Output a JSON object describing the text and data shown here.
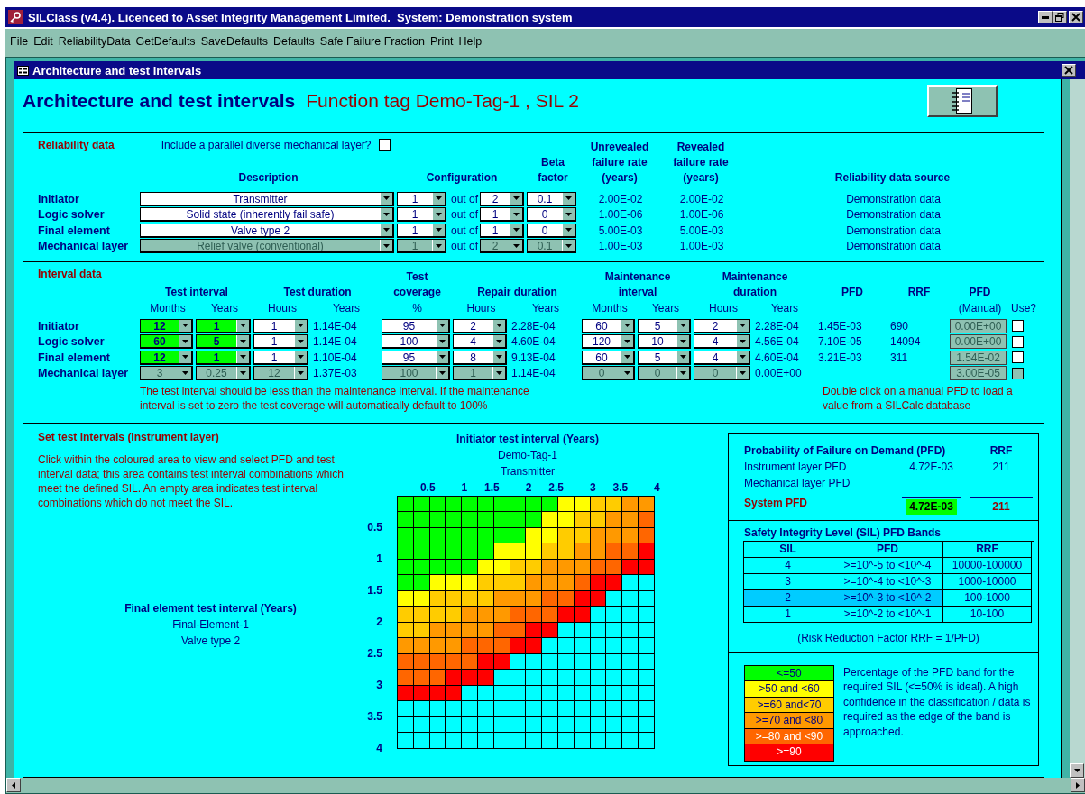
{
  "window": {
    "title": "SILClass (v4.4). Licenced to Asset Integrity Management Limited.  System: Demonstration system"
  },
  "menu": [
    "File",
    "Edit",
    "ReliabilityData",
    "GetDefaults",
    "SaveDefaults",
    "Defaults",
    "Safe Failure Fraction",
    "Print",
    "Help"
  ],
  "form": {
    "title": "Architecture and test intervals"
  },
  "heading": {
    "title": "Architecture and test intervals",
    "subtitle": "Function tag Demo-Tag-1 , SIL 2"
  },
  "reliability": {
    "label": "Reliability data",
    "parallel_label": "Include a parallel diverse mechanical layer?",
    "parallel_checked": false,
    "headers": {
      "description": "Description",
      "configuration": "Configuration",
      "beta": "Beta factor",
      "unrevealed": "Unrevealed failure rate (years)",
      "revealed": "Revealed failure rate (years)",
      "source": "Reliability data source"
    },
    "rows": [
      {
        "name": "Initiator",
        "description": "Transmitter",
        "m": "1",
        "out_of": "out of",
        "n": "2",
        "beta": "0.1",
        "unrevealed": "2.00E-02",
        "revealed": "2.00E-02",
        "source": "Demonstration data",
        "disabled": false
      },
      {
        "name": "Logic solver",
        "description": "Solid state (inherently fail safe)",
        "m": "1",
        "out_of": "out of",
        "n": "1",
        "beta": "0",
        "unrevealed": "1.00E-06",
        "revealed": "1.00E-06",
        "source": "Demonstration data",
        "disabled": false
      },
      {
        "name": "Final element",
        "description": "Valve type 2",
        "m": "1",
        "out_of": "out of",
        "n": "1",
        "beta": "0",
        "unrevealed": "5.00E-03",
        "revealed": "5.00E-03",
        "source": "Demonstration data",
        "disabled": false
      },
      {
        "name": "Mechanical layer",
        "description": "Relief valve (conventional)",
        "m": "1",
        "out_of": "out of",
        "n": "2",
        "beta": "0.1",
        "unrevealed": "1.00E-03",
        "revealed": "1.00E-03",
        "source": "Demonstration data",
        "disabled": true
      }
    ]
  },
  "interval": {
    "label": "Interval data",
    "columns": [
      {
        "group": "Test interval",
        "sub": "Months"
      },
      {
        "sub": "Years"
      },
      {
        "group": "Test duration",
        "sub": "Hours"
      },
      {
        "sub": "Years"
      },
      {
        "group": "Test coverage",
        "sub": "%"
      },
      {
        "group": "Repair duration",
        "sub": "Hours"
      },
      {
        "sub": "Years"
      },
      {
        "group": "Maintenance interval",
        "sub": "Months"
      },
      {
        "sub": "Years"
      },
      {
        "group": "Maintenance duration",
        "sub": "Hours"
      },
      {
        "sub": "Years"
      },
      {
        "group": "PFD"
      },
      {
        "group": "RRF"
      },
      {
        "group": "PFD",
        "sub": "(Manual)"
      },
      {
        "sub": "Use?"
      }
    ],
    "rows": [
      {
        "name": "Initiator",
        "highlight": true,
        "disabled": false,
        "ti_months": "12",
        "ti_years": "1",
        "td_hours": "1",
        "td_years": "1.14E-04",
        "coverage": "95",
        "rd_hours": "2",
        "rd_years": "2.28E-04",
        "mi_months": "60",
        "mi_years": "5",
        "md_hours": "2",
        "md_years": "2.28E-04",
        "pfd": "1.45E-03",
        "rrf": "690",
        "manual_pfd": "0.00E+00",
        "use": false
      },
      {
        "name": "Logic solver",
        "highlight": true,
        "disabled": false,
        "ti_months": "60",
        "ti_years": "5",
        "td_hours": "1",
        "td_years": "1.14E-04",
        "coverage": "100",
        "rd_hours": "4",
        "rd_years": "4.60E-04",
        "mi_months": "120",
        "mi_years": "10",
        "md_hours": "4",
        "md_years": "4.56E-04",
        "pfd": "7.10E-05",
        "rrf": "14094",
        "manual_pfd": "0.00E+00",
        "use": false
      },
      {
        "name": "Final element",
        "highlight": true,
        "disabled": false,
        "ti_months": "12",
        "ti_years": "1",
        "td_hours": "1",
        "td_years": "1.10E-04",
        "coverage": "95",
        "rd_hours": "8",
        "rd_years": "9.13E-04",
        "mi_months": "60",
        "mi_years": "5",
        "md_hours": "4",
        "md_years": "4.60E-04",
        "pfd": "3.21E-03",
        "rrf": "311",
        "manual_pfd": "1.54E-02",
        "use": false
      },
      {
        "name": "Mechanical layer",
        "highlight": false,
        "disabled": true,
        "ti_months": "3",
        "ti_years": "0.25",
        "td_hours": "12",
        "td_years": "1.37E-03",
        "coverage": "100",
        "rd_hours": "1",
        "rd_years": "1.14E-04",
        "mi_months": "0",
        "mi_years": "0",
        "md_hours": "0",
        "md_years": "0.00E+00",
        "manual_pfd": "3.00E-05",
        "use": false
      }
    ],
    "note": "The test interval should be less than the maintenance interval. If the maintenance interval is set to zero the  test coverage will automatically default to 100%",
    "manual_note": "Double click on a manual PFD to load a value from a SILCalc database"
  },
  "set_intervals": {
    "title": "Set test intervals (Instrument layer)",
    "text": "Click within the coloured area to view and select PFD and test interval data; this area contains test interval combinations which meet the defined SIL. An empty area indicates test interval combinations which do not meet the SIL.",
    "y_title": "Final element test interval (Years)",
    "y_tag": "Final-Element-1",
    "y_desc": "Valve type 2",
    "x_title": "Initiator test interval (Years)",
    "x_tag": "Demo-Tag-1",
    "x_desc": "Transmitter",
    "x_ticks": [
      "0.5",
      "1",
      "1.5",
      "2",
      "2.5",
      "3",
      "3.5",
      "4"
    ],
    "y_ticks": [
      "0.5",
      "1",
      "1.5",
      "2",
      "2.5",
      "3",
      "3.5",
      "4"
    ],
    "grid": [
      [
        {
          "color": "#00ff00"
        },
        {
          "color": "#00ff00"
        },
        {
          "color": "#00ff00"
        },
        {
          "color": "#00ff00"
        },
        {
          "color": "#00ff00"
        },
        {
          "color": "#00ff00"
        },
        {
          "color": "#00ff00"
        },
        {
          "color": "#00ff00"
        },
        {
          "color": "#00ff00"
        },
        {
          "color": "#00ff00"
        },
        {
          "color": "#ffff00"
        },
        {
          "color": "#ffff00"
        },
        {
          "color": "#ffcc00"
        },
        {
          "color": "#ffcc00"
        },
        {
          "color": "#ff9900"
        },
        {
          "color": "#ff9900"
        }
      ],
      [
        {
          "color": "#00ff00"
        },
        {
          "color": "#00ff00"
        },
        {
          "color": "#00ff00"
        },
        {
          "color": "#00ff00"
        },
        {
          "color": "#00ff00"
        },
        {
          "color": "#00ff00"
        },
        {
          "color": "#00ff00"
        },
        {
          "color": "#00ff00"
        },
        {
          "color": "#00ff00"
        },
        {
          "color": "#ffff00"
        },
        {
          "color": "#ffff00"
        },
        {
          "color": "#ffcc00"
        },
        {
          "color": "#ffcc00"
        },
        {
          "color": "#ff9900"
        },
        {
          "color": "#ff9900"
        },
        {
          "color": "#ff6600"
        }
      ],
      [
        {
          "color": "#00ff00"
        },
        {
          "color": "#00ff00"
        },
        {
          "color": "#00ff00"
        },
        {
          "color": "#00ff00"
        },
        {
          "color": "#00ff00"
        },
        {
          "color": "#00ff00"
        },
        {
          "color": "#00ff00"
        },
        {
          "color": "#00ff00"
        },
        {
          "color": "#ffff00"
        },
        {
          "color": "#ffff00"
        },
        {
          "color": "#ffcc00"
        },
        {
          "color": "#ffcc00"
        },
        {
          "color": "#ff9900"
        },
        {
          "color": "#ff9900"
        },
        {
          "color": "#ff9900"
        },
        {
          "color": "#ff6600"
        }
      ],
      [
        {
          "color": "#00ff00"
        },
        {
          "color": "#00ff00"
        },
        {
          "color": "#00ff00"
        },
        {
          "color": "#00ff00"
        },
        {
          "color": "#00ff00"
        },
        {
          "color": "#00ff00"
        },
        {
          "color": "#ffff00"
        },
        {
          "color": "#ffff00"
        },
        {
          "color": "#ffff00"
        },
        {
          "color": "#ffcc00"
        },
        {
          "color": "#ffcc00"
        },
        {
          "color": "#ff9900"
        },
        {
          "color": "#ff9900"
        },
        {
          "color": "#ff6600"
        },
        {
          "color": "#ff6600"
        },
        {
          "color": "#ff0000"
        }
      ],
      [
        {
          "color": "#00ff00"
        },
        {
          "color": "#00ff00"
        },
        {
          "color": "#00ff00"
        },
        {
          "color": "#00ff00"
        },
        {
          "color": "#00ff00"
        },
        {
          "color": "#ffff00"
        },
        {
          "color": "#ffff00"
        },
        {
          "color": "#ffcc00"
        },
        {
          "color": "#ffcc00"
        },
        {
          "color": "#ff9900"
        },
        {
          "color": "#ff9900"
        },
        {
          "color": "#ff9900"
        },
        {
          "color": "#ff6600"
        },
        {
          "color": "#ff6600"
        },
        {
          "color": "#ff0000"
        },
        {
          "color": "#ff0000"
        }
      ],
      [
        {
          "color": "#00ff00"
        },
        {
          "color": "#00ff00"
        },
        {
          "color": "#ffff00"
        },
        {
          "color": "#ffff00"
        },
        {
          "color": "#ffff00"
        },
        {
          "color": "#ffcc00"
        },
        {
          "color": "#ffcc00"
        },
        {
          "color": "#ffcc00"
        },
        {
          "color": "#ff9900"
        },
        {
          "color": "#ff9900"
        },
        {
          "color": "#ff9900"
        },
        {
          "color": "#ff6600"
        },
        {
          "color": "#ff0000"
        },
        {
          "color": "#ff0000"
        },
        {
          "color": "#00ffff"
        },
        {
          "color": "#00ffff"
        }
      ],
      [
        {
          "color": "#ffff00"
        },
        {
          "color": "#ffff00"
        },
        {
          "color": "#ffcc00"
        },
        {
          "color": "#ffcc00"
        },
        {
          "color": "#ffcc00"
        },
        {
          "color": "#ffcc00"
        },
        {
          "color": "#ff9900"
        },
        {
          "color": "#ff9900"
        },
        {
          "color": "#ff9900"
        },
        {
          "color": "#ff6600"
        },
        {
          "color": "#ff6600"
        },
        {
          "color": "#ff0000"
        },
        {
          "color": "#ff0000"
        },
        {
          "color": "#00ffff"
        },
        {
          "color": "#00ffff"
        },
        {
          "color": "#00ffff"
        }
      ],
      [
        {
          "color": "#ffcc00"
        },
        {
          "color": "#ffcc00"
        },
        {
          "color": "#ffcc00"
        },
        {
          "color": "#ffcc00"
        },
        {
          "color": "#ff9900"
        },
        {
          "color": "#ff9900"
        },
        {
          "color": "#ff9900"
        },
        {
          "color": "#ff6600"
        },
        {
          "color": "#ff6600"
        },
        {
          "color": "#ff6600"
        },
        {
          "color": "#ff0000"
        },
        {
          "color": "#ff0000"
        },
        {
          "color": "#00ffff"
        },
        {
          "color": "#00ffff"
        },
        {
          "color": "#00ffff"
        },
        {
          "color": "#00ffff"
        }
      ],
      [
        {
          "color": "#ffcc00"
        },
        {
          "color": "#ffcc00"
        },
        {
          "color": "#ff9900"
        },
        {
          "color": "#ff9900"
        },
        {
          "color": "#ff9900"
        },
        {
          "color": "#ff9900"
        },
        {
          "color": "#ff6600"
        },
        {
          "color": "#ff6600"
        },
        {
          "color": "#ff0000"
        },
        {
          "color": "#ff0000"
        },
        {
          "color": "#00ffff"
        },
        {
          "color": "#00ffff"
        },
        {
          "color": "#00ffff"
        },
        {
          "color": "#00ffff"
        },
        {
          "color": "#00ffff"
        },
        {
          "color": "#00ffff"
        }
      ],
      [
        {
          "color": "#ff9900"
        },
        {
          "color": "#ff9900"
        },
        {
          "color": "#ff9900"
        },
        {
          "color": "#ff9900"
        },
        {
          "color": "#ff6600"
        },
        {
          "color": "#ff6600"
        },
        {
          "color": "#ff6600"
        },
        {
          "color": "#ff0000"
        },
        {
          "color": "#ff0000"
        },
        {
          "color": "#00ffff"
        },
        {
          "color": "#00ffff"
        },
        {
          "color": "#00ffff"
        },
        {
          "color": "#00ffff"
        },
        {
          "color": "#00ffff"
        },
        {
          "color": "#00ffff"
        },
        {
          "color": "#00ffff"
        }
      ],
      [
        {
          "color": "#ff6600"
        },
        {
          "color": "#ff6600"
        },
        {
          "color": "#ff6600"
        },
        {
          "color": "#ff6600"
        },
        {
          "color": "#ff6600"
        },
        {
          "color": "#ff0000"
        },
        {
          "color": "#ff0000"
        },
        {
          "color": "#00ffff"
        },
        {
          "color": "#00ffff"
        },
        {
          "color": "#00ffff"
        },
        {
          "color": "#00ffff"
        },
        {
          "color": "#00ffff"
        },
        {
          "color": "#00ffff"
        },
        {
          "color": "#00ffff"
        },
        {
          "color": "#00ffff"
        },
        {
          "color": "#00ffff"
        }
      ],
      [
        {
          "color": "#ff6600"
        },
        {
          "color": "#ff6600"
        },
        {
          "color": "#ff6600"
        },
        {
          "color": "#ff0000"
        },
        {
          "color": "#ff0000"
        },
        {
          "color": "#ff0000"
        },
        {
          "color": "#00ffff"
        },
        {
          "color": "#00ffff"
        },
        {
          "color": "#00ffff"
        },
        {
          "color": "#00ffff"
        },
        {
          "color": "#00ffff"
        },
        {
          "color": "#00ffff"
        },
        {
          "color": "#00ffff"
        },
        {
          "color": "#00ffff"
        },
        {
          "color": "#00ffff"
        },
        {
          "color": "#00ffff"
        }
      ],
      [
        {
          "color": "#ff0000"
        },
        {
          "color": "#ff0000"
        },
        {
          "color": "#ff0000"
        },
        {
          "color": "#ff0000"
        },
        {
          "color": "#00ffff"
        },
        {
          "color": "#00ffff"
        },
        {
          "color": "#00ffff"
        },
        {
          "color": "#00ffff"
        },
        {
          "color": "#00ffff"
        },
        {
          "color": "#00ffff"
        },
        {
          "color": "#00ffff"
        },
        {
          "color": "#00ffff"
        },
        {
          "color": "#00ffff"
        },
        {
          "color": "#00ffff"
        },
        {
          "color": "#00ffff"
        },
        {
          "color": "#00ffff"
        }
      ],
      [
        {
          "color": "#00ffff"
        },
        {
          "color": "#00ffff"
        },
        {
          "color": "#00ffff"
        },
        {
          "color": "#00ffff"
        },
        {
          "color": "#00ffff"
        },
        {
          "color": "#00ffff"
        },
        {
          "color": "#00ffff"
        },
        {
          "color": "#00ffff"
        },
        {
          "color": "#00ffff"
        },
        {
          "color": "#00ffff"
        },
        {
          "color": "#00ffff"
        },
        {
          "color": "#00ffff"
        },
        {
          "color": "#00ffff"
        },
        {
          "color": "#00ffff"
        },
        {
          "color": "#00ffff"
        },
        {
          "color": "#00ffff"
        }
      ],
      [
        {
          "color": "#00ffff"
        },
        {
          "color": "#00ffff"
        },
        {
          "color": "#00ffff"
        },
        {
          "color": "#00ffff"
        },
        {
          "color": "#00ffff"
        },
        {
          "color": "#00ffff"
        },
        {
          "color": "#00ffff"
        },
        {
          "color": "#00ffff"
        },
        {
          "color": "#00ffff"
        },
        {
          "color": "#00ffff"
        },
        {
          "color": "#00ffff"
        },
        {
          "color": "#00ffff"
        },
        {
          "color": "#00ffff"
        },
        {
          "color": "#00ffff"
        },
        {
          "color": "#00ffff"
        },
        {
          "color": "#00ffff"
        }
      ],
      [
        {
          "color": "#00ffff"
        },
        {
          "color": "#00ffff"
        },
        {
          "color": "#00ffff"
        },
        {
          "color": "#00ffff"
        },
        {
          "color": "#00ffff"
        },
        {
          "color": "#00ffff"
        },
        {
          "color": "#00ffff"
        },
        {
          "color": "#00ffff"
        },
        {
          "color": "#00ffff"
        },
        {
          "color": "#00ffff"
        },
        {
          "color": "#00ffff"
        },
        {
          "color": "#00ffff"
        },
        {
          "color": "#00ffff"
        },
        {
          "color": "#00ffff"
        },
        {
          "color": "#00ffff"
        },
        {
          "color": "#00ffff"
        }
      ]
    ]
  },
  "summary": {
    "title": "Probability of Failure on Demand (PFD)",
    "rrf_label": "RRF",
    "rows": [
      {
        "label": "Instrument layer PFD",
        "pfd": "4.72E-03",
        "rrf": "211"
      },
      {
        "label": "Mechanical layer PFD"
      }
    ],
    "system": {
      "label": "System PFD",
      "pfd": "4.72E-03",
      "rrf": "211",
      "color": "#00ff00"
    }
  },
  "sil_bands": {
    "title": "Safety Integrity Level (SIL) PFD Bands",
    "columns": [
      "SIL",
      "PFD",
      "RRF"
    ],
    "rows": [
      {
        "sil": "4",
        "pfd": ">=10^-5 to <10^-4",
        "rrf": "10000-100000",
        "selected": false
      },
      {
        "sil": "3",
        "pfd": ">=10^-4 to <10^-3",
        "rrf": "1000-10000",
        "selected": false
      },
      {
        "sil": "2",
        "pfd": ">=10^-3 to <10^-2",
        "rrf": "100-1000",
        "selected": true
      },
      {
        "sil": "1",
        "pfd": ">=10^-2 to <10^-1",
        "rrf": "10-100",
        "selected": false
      }
    ],
    "note": "(Risk Reduction Factor RRF = 1/PFD)"
  },
  "legend": {
    "bands": [
      {
        "label": "<=50",
        "color": "#00ff00"
      },
      {
        "label": ">50 and <60",
        "color": "#ffff00"
      },
      {
        "label": ">=60 and<70",
        "color": "#ffcc00"
      },
      {
        "label": ">=70 and <80",
        "color": "#ff9900"
      },
      {
        "label": ">=80 and <90",
        "color": "#ff6600"
      },
      {
        "label": ">=90",
        "color": "#ff0000"
      }
    ],
    "text": "Percentage of the PFD band for the required SIL (<=50% is ideal). A high confidence in the classification / data is required as the edge of the band is approached."
  }
}
